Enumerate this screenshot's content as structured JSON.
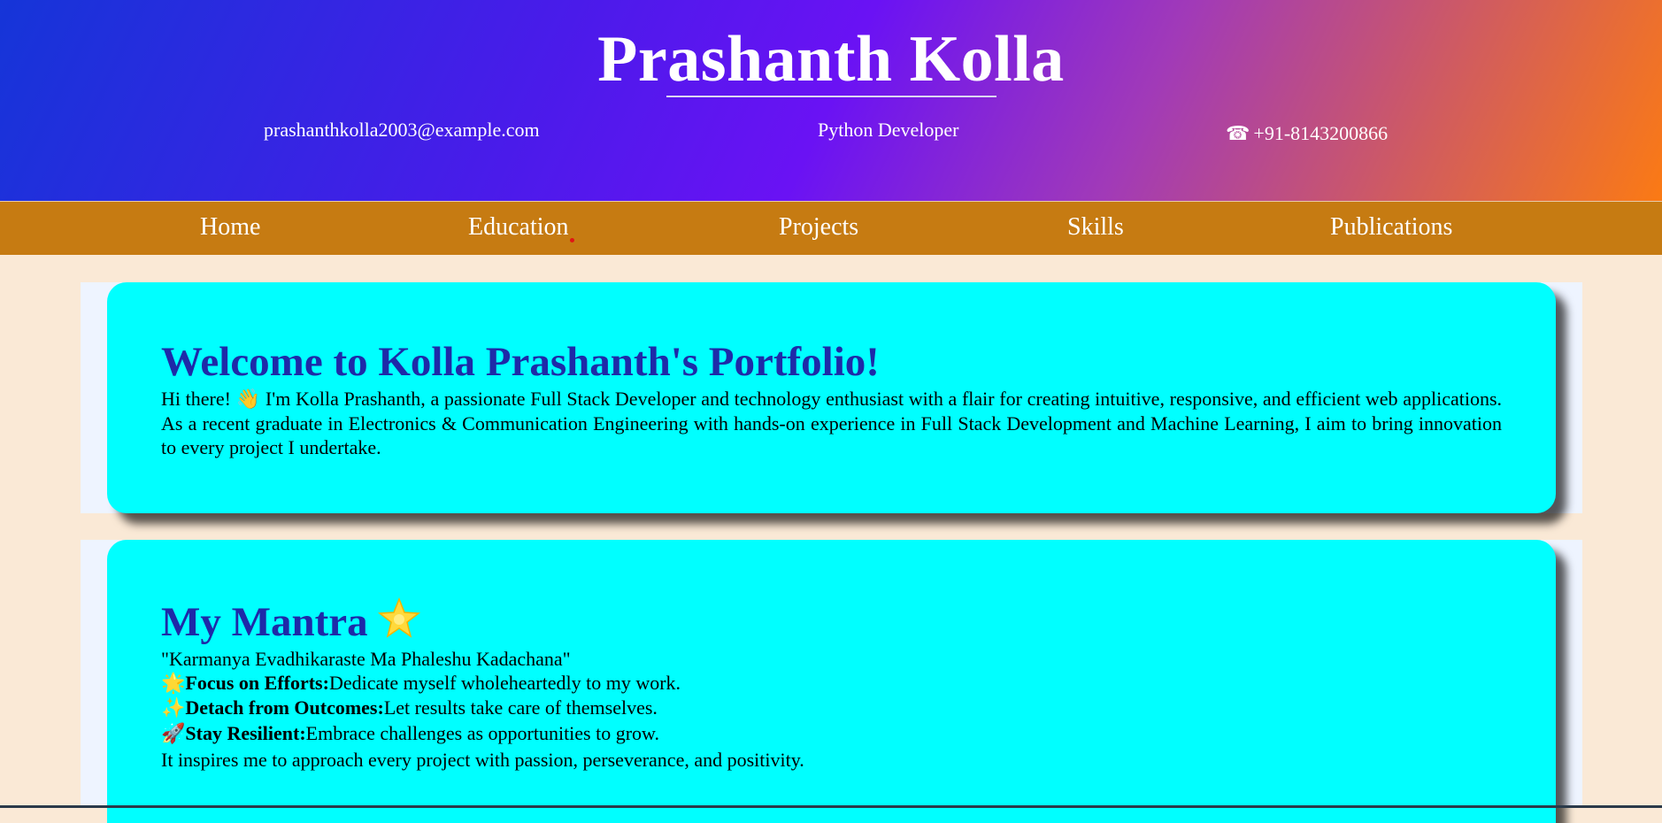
{
  "header": {
    "title": "Prashanth Kolla",
    "email": "prashanthkolla2003@example.com",
    "role": "Python Developer",
    "phone": "+91-8143200866",
    "phone_icon": "phone-icon"
  },
  "nav": {
    "items": [
      {
        "label": "Home"
      },
      {
        "label": "Education"
      },
      {
        "label": "Projects"
      },
      {
        "label": "Skills"
      },
      {
        "label": "Publications"
      }
    ]
  },
  "welcome": {
    "heading": "Welcome to Kolla Prashanth's Portfolio!",
    "text_before_emoji": "Hi there!",
    "wave_emoji": "👋",
    "text_after_emoji": "I'm Kolla Prashanth, a passionate Full Stack Developer and technology enthusiast with a flair for creating intuitive, responsive, and efficient web applications. As a recent graduate in Electronics & Communication Engineering with hands-on experience in Full Stack Development and Machine Learning, I aim to bring innovation to every project I undertake."
  },
  "mantra": {
    "heading": "My Mantra",
    "heading_icon": "glowing-star-icon",
    "quote": "\"Karmanya Evadhikaraste Ma Phaleshu Kadachana\"",
    "points": [
      {
        "emoji": "🌟",
        "title": "Focus on Efforts:",
        "text": "Dedicate myself wholeheartedly to my work."
      },
      {
        "emoji": "✨",
        "title": "Detach from Outcomes:",
        "text": "Let results take care of themselves."
      },
      {
        "emoji": "🚀",
        "title": "Stay Resilient:",
        "text": "Embrace challenges as opportunities to grow."
      }
    ],
    "closing": "It inspires me to approach every project with passion, perseverance, and positivity."
  },
  "colors": {
    "header_gradient": [
      "#1535d8",
      "#6a12f4",
      "#fb7a14"
    ],
    "nav_bg": "#c67b12",
    "card_bg": "#00ffff",
    "heading_color": "#1e2aa8",
    "page_bg": "#fae9d6"
  }
}
